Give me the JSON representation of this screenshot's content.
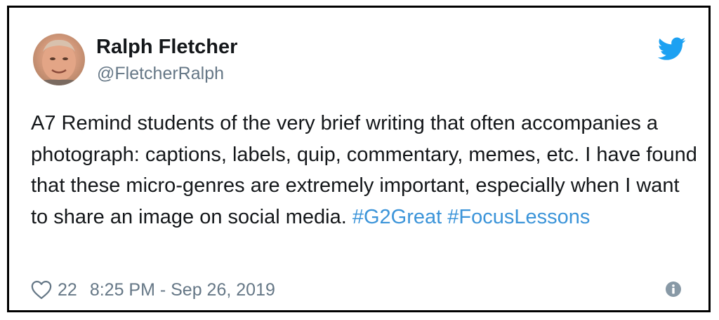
{
  "tweet": {
    "author_name": "Ralph Fletcher",
    "author_handle": "@FletcherRalph",
    "text": "A7 Remind students of the very brief writing that often accompanies a photograph: captions, labels, quip, commentary, memes, etc. I have found that these micro-genres are extremely important, especially when I want to share an image on social media.",
    "hashtags": [
      "#G2Great",
      "#FocusLessons"
    ],
    "like_count": "22",
    "timestamp": "8:25 PM - Sep 26, 2019"
  },
  "icons": {
    "brand": "twitter-bird-icon",
    "like": "heart-icon",
    "info": "info-icon",
    "avatar": "profile-photo"
  },
  "colors": {
    "twitter_blue": "#1da1f2",
    "hashtag": "#3b94d9",
    "text": "#14171a",
    "muted": "#657786",
    "frame_border": "#000000"
  }
}
